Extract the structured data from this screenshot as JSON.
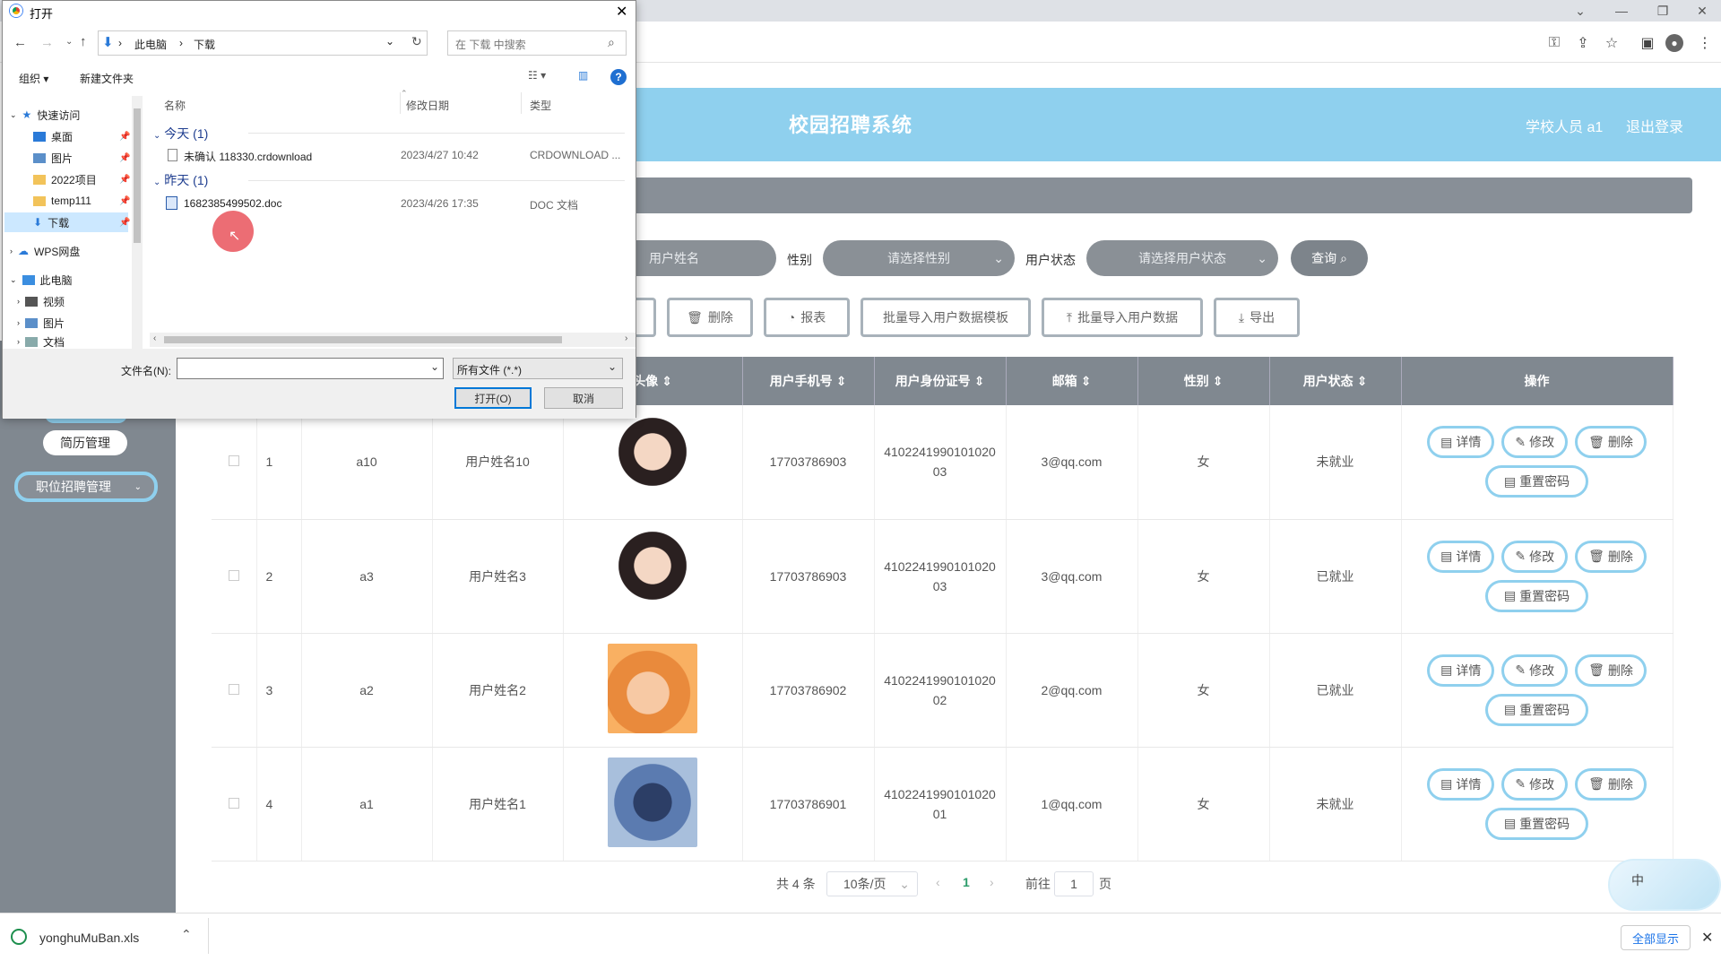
{
  "browser": {
    "title_controls": [
      "⌄",
      "—",
      "❐",
      "✕"
    ],
    "toolbar_icons": [
      "key-icon",
      "share-icon",
      "star-icon",
      "sidebar-icon",
      "profile-icon",
      "menu-icon"
    ]
  },
  "site": {
    "title": "校园招聘系统",
    "user_label": "学校人员 a1",
    "logout": "退出登录"
  },
  "sidebar": {
    "resume_mgmt": "简历管理",
    "job_mgmt": "职位招聘管理"
  },
  "filters": {
    "name_placeholder": "用户姓名",
    "gender_label": "性别",
    "gender_placeholder": "请选择性别",
    "status_label": "用户状态",
    "status_placeholder": "请选择用户状态",
    "query": "查询"
  },
  "toolbar": {
    "delete": "删除",
    "report": "报表",
    "import_template": "批量导入用户数据模板",
    "import_data": "批量导入用户数据",
    "export": "导出"
  },
  "table": {
    "headers": {
      "avatar": "头像",
      "phone": "用户手机号",
      "idcard": "用户身份证号",
      "email": "邮箱",
      "gender": "性别",
      "status": "用户状态",
      "ops": "操作"
    },
    "rows": [
      {
        "idx": "1",
        "account": "a10",
        "name": "用户姓名10",
        "phone": "17703786903",
        "idcard": "410224199010102003",
        "email": "3@qq.com",
        "gender": "女",
        "status": "未就业"
      },
      {
        "idx": "2",
        "account": "a3",
        "name": "用户姓名3",
        "phone": "17703786903",
        "idcard": "410224199010102003",
        "email": "3@qq.com",
        "gender": "女",
        "status": "已就业"
      },
      {
        "idx": "3",
        "account": "a2",
        "name": "用户姓名2",
        "phone": "17703786902",
        "idcard": "410224199010102002",
        "email": "2@qq.com",
        "gender": "女",
        "status": "已就业"
      },
      {
        "idx": "4",
        "account": "a1",
        "name": "用户姓名1",
        "phone": "17703786901",
        "idcard": "410224199010102001",
        "email": "1@qq.com",
        "gender": "女",
        "status": "未就业"
      }
    ],
    "op_detail": "详情",
    "op_edit": "修改",
    "op_delete": "删除",
    "op_reset": "重置密码"
  },
  "pagination": {
    "total": "共 4 条",
    "page_size": "10条/页",
    "current": "1",
    "goto_label": "前往",
    "goto_value": "1",
    "page_unit": "页"
  },
  "download_bar": {
    "filename": "yonghuMuBan.xls",
    "show_all": "全部显示"
  },
  "ime": {
    "label": "中"
  },
  "dialog": {
    "title": "打开",
    "path": [
      "此电脑",
      "下载"
    ],
    "search_placeholder": "在 下载 中搜索",
    "organize": "组织",
    "new_folder": "新建文件夹",
    "tree": [
      "快速访问",
      "桌面",
      "图片",
      "2022项目",
      "temp111",
      "下载",
      "WPS网盘",
      "此电脑",
      "视频",
      "图片",
      "文档"
    ],
    "columns": {
      "name": "名称",
      "modified": "修改日期",
      "type": "类型"
    },
    "groups": [
      {
        "label": "今天 (1)",
        "files": [
          {
            "name": "未确认 118330.crdownload",
            "date": "2023/4/27 10:42",
            "type": "CRDOWNLOAD ..."
          }
        ]
      },
      {
        "label": "昨天 (1)",
        "files": [
          {
            "name": "1682385499502.doc",
            "date": "2023/4/26 17:35",
            "type": "DOC 文档"
          }
        ]
      }
    ],
    "filename_label": "文件名(N):",
    "filename_value": "",
    "filetype": "所有文件 (*.*)",
    "open_btn": "打开(O)",
    "cancel_btn": "取消"
  }
}
